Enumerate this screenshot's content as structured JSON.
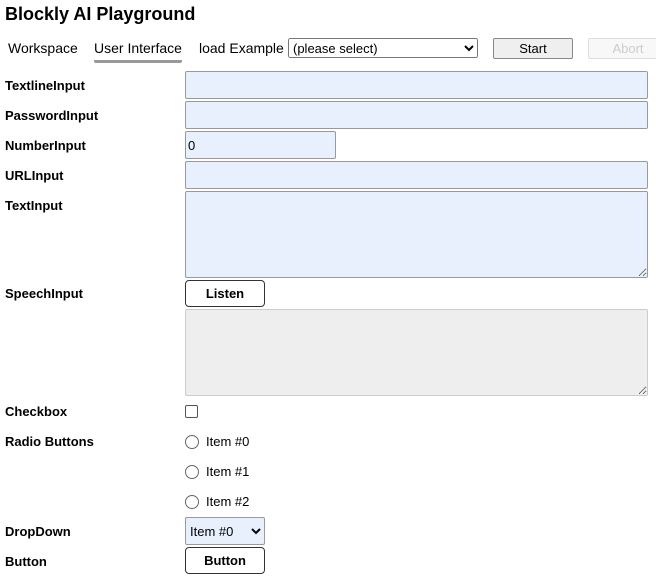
{
  "title": "Blockly AI Playground",
  "tabs": [
    {
      "label": "Workspace"
    },
    {
      "label": "User Interface"
    }
  ],
  "load_example": {
    "label": "load Example",
    "selected": "(please select)"
  },
  "buttons": {
    "start": "Start",
    "abort": "Abort"
  },
  "form": {
    "textline": {
      "label": "TextlineInput",
      "value": ""
    },
    "password": {
      "label": "PasswordInput",
      "value": ""
    },
    "number": {
      "label": "NumberInput",
      "value": "0"
    },
    "url": {
      "label": "URLInput",
      "value": ""
    },
    "text": {
      "label": "TextInput",
      "value": ""
    },
    "speech": {
      "label": "SpeechInput",
      "button": "Listen"
    },
    "checkbox": {
      "label": "Checkbox",
      "checked": false
    },
    "radio": {
      "label": "Radio Buttons",
      "items": [
        "Item #0",
        "Item #1",
        "Item #2"
      ]
    },
    "dropdown": {
      "label": "DropDown",
      "selected": "Item #0"
    },
    "button": {
      "label": "Button",
      "text": "Button"
    }
  }
}
